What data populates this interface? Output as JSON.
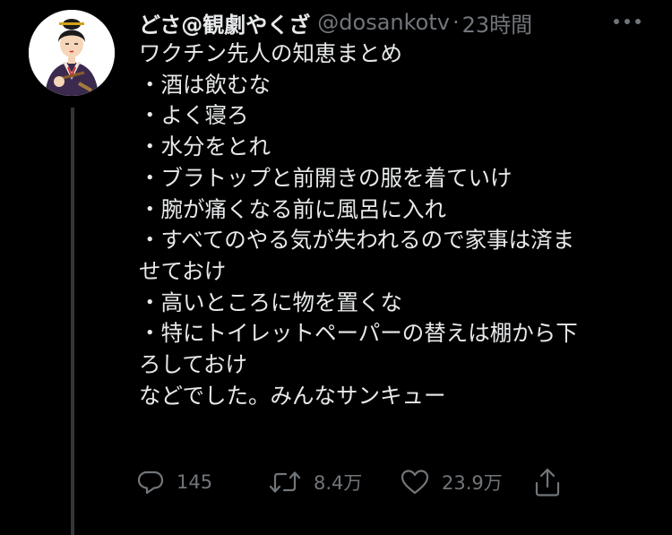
{
  "tweet": {
    "display_name": "どさ@観劇やくざ",
    "handle": "@dosankotv",
    "separator": "·",
    "timestamp": "23時間",
    "lines": [
      "ワクチン先人の知恵まとめ",
      "・酒は飲むな",
      "・よく寝ろ",
      "・水分をとれ",
      "・ブラトップと前開きの服を着ていけ",
      "・腕が痛くなる前に風呂に入れ",
      "・すべてのやる気が失われるので家事は済ま",
      "せておけ",
      "・高いところに物を置くな",
      "・特にトイレットペーパーの替えは棚から下",
      "ろしておけ",
      "などでした。みんなサンキュー"
    ]
  },
  "actions": {
    "reply_count": "145",
    "retweet_count": "8.4万",
    "like_count": "23.9万"
  },
  "icons": {
    "more": "more-icon",
    "reply": "reply-icon",
    "retweet": "retweet-icon",
    "like": "heart-icon",
    "share": "share-icon"
  },
  "colors": {
    "background": "#000000",
    "primary_text": "#e7e9ea",
    "secondary_text": "#71767b",
    "thread_line": "#333639"
  }
}
